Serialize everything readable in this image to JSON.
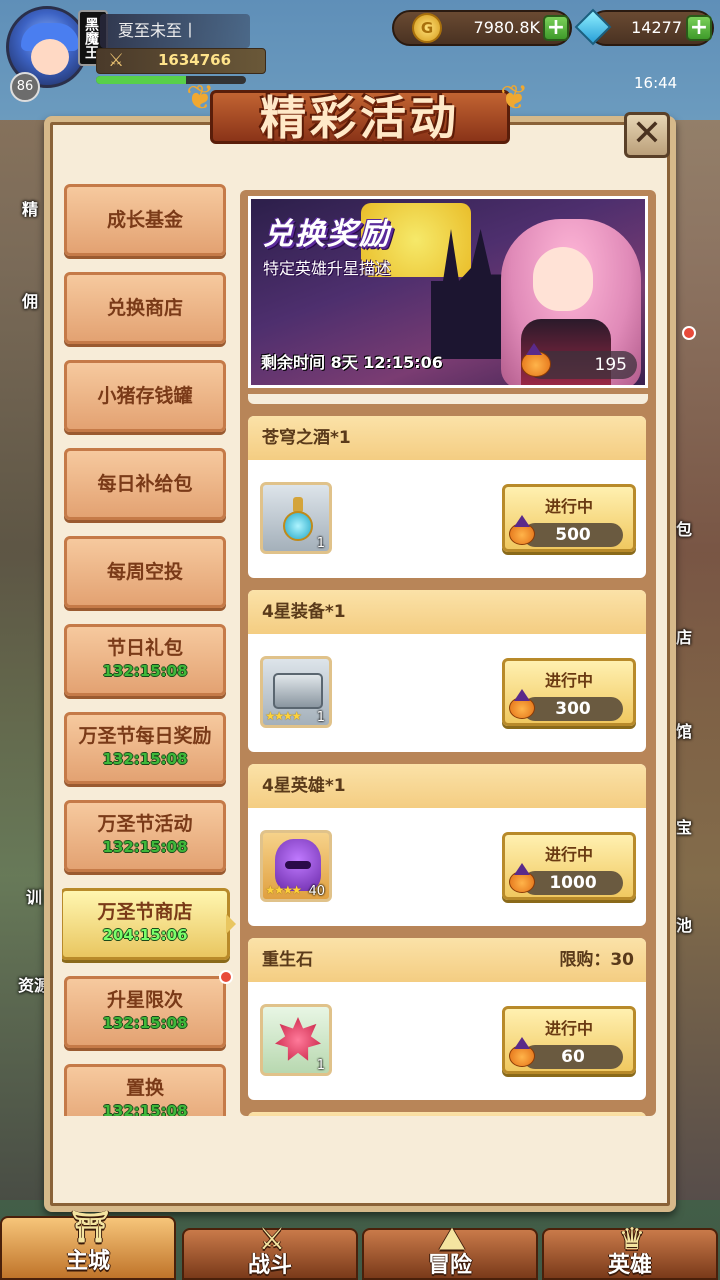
{
  "player": {
    "name": "夏至未至丨",
    "vip_label": "黑魔王",
    "level": "86",
    "power": "1634766",
    "exp_fraction": 0.6
  },
  "currency": {
    "gold": "7980.8K",
    "gold_icon_letter": "G",
    "gems": "14277",
    "plus": "+"
  },
  "clock": "16:44",
  "background_labels": {
    "left": [
      "精",
      "佣",
      "训",
      "资源"
    ],
    "right": [
      "包",
      "店",
      "馆",
      "宝",
      "池"
    ]
  },
  "panel": {
    "title": "精彩活动",
    "close_glyph": "✕"
  },
  "menu": [
    {
      "label": "成长基金",
      "timer": ""
    },
    {
      "label": "兑换商店",
      "timer": ""
    },
    {
      "label": "小猪存钱罐",
      "timer": ""
    },
    {
      "label": "每日补给包",
      "timer": ""
    },
    {
      "label": "每周空投",
      "timer": ""
    },
    {
      "label": "节日礼包",
      "timer": "132:15:08"
    },
    {
      "label": "万圣节每日奖励",
      "timer": "132:15:08"
    },
    {
      "label": "万圣节活动",
      "timer": "132:15:08"
    },
    {
      "label": "万圣节商店",
      "timer": "204:15:06",
      "active": true
    },
    {
      "label": "升星限次",
      "timer": "132:15:08",
      "badge": true
    },
    {
      "label": "置换",
      "timer": "132:15:08"
    }
  ],
  "event_banner": {
    "title": "兑换奖励",
    "subtitle": "特定英雄升星描述",
    "time_label": "剩余时间",
    "time_value": "8天 12:15:06",
    "points": "195"
  },
  "rewards": [
    {
      "name": "苍穹之酒*1",
      "limit": "",
      "icon": "potion-icon",
      "count": "1",
      "stars": "",
      "status": "进行中",
      "cost": "500"
    },
    {
      "name": "4星装备*1",
      "limit": "",
      "icon": "armor-chest-icon",
      "count": "1",
      "stars": "★★★★",
      "status": "进行中",
      "cost": "300"
    },
    {
      "name": "4星英雄*1",
      "limit": "",
      "icon": "hero-shard-icon",
      "count": "40",
      "stars": "★★★★",
      "status": "进行中",
      "cost": "1000"
    },
    {
      "name": "重生石",
      "limit": "限购：30",
      "icon": "rebirth-stone-icon",
      "count": "1",
      "stars": "",
      "status": "进行中",
      "cost": "60"
    }
  ],
  "bottom_nav": [
    {
      "label": "主城",
      "active": true
    },
    {
      "label": "战斗"
    },
    {
      "label": "冒险"
    },
    {
      "label": "英雄"
    }
  ]
}
